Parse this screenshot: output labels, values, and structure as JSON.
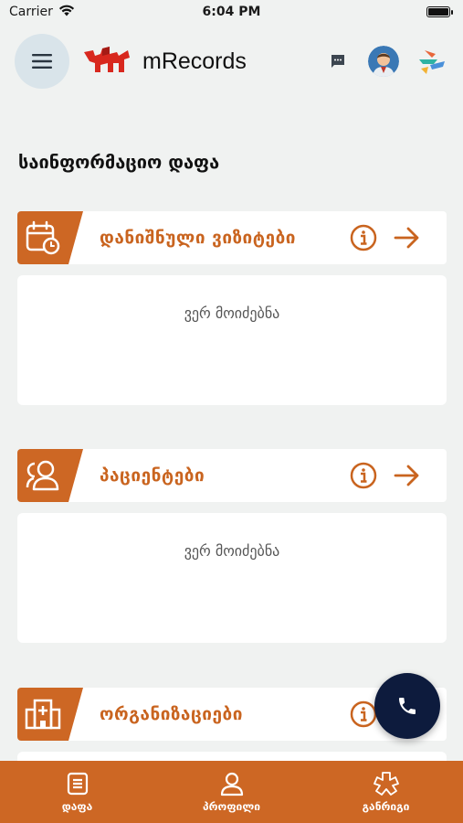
{
  "status_bar": {
    "carrier": "Carrier",
    "time": "6:04 PM"
  },
  "header": {
    "app_title": "mRecords"
  },
  "main": {
    "section_title": "საინფორმაციო დაფა",
    "cards": [
      {
        "title": "დანიშნული ვიზიტები",
        "empty_text": "ვერ მოიძებნა",
        "icon": "calendar-clock-icon"
      },
      {
        "title": "პაციენტები",
        "empty_text": "ვერ მოიძებნა",
        "icon": "patients-icon"
      },
      {
        "title": "ორგანიზაციები",
        "empty_text": "",
        "icon": "hospital-icon"
      }
    ]
  },
  "bottom_nav": {
    "items": [
      {
        "label": "დაფა",
        "icon": "dashboard-icon"
      },
      {
        "label": "პროფილი",
        "icon": "profile-icon"
      },
      {
        "label": "განრიგი",
        "icon": "schedule-icon"
      }
    ]
  },
  "colors": {
    "accent": "#cd6724",
    "accent_text": "#c9641f",
    "fab": "#0d1b3d",
    "background": "#f0f2f1"
  }
}
